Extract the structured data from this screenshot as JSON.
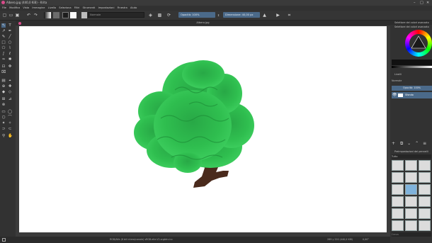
{
  "window": {
    "title": "Albero.jpg (440,0 KiB) - Krita",
    "minimize": "–",
    "maximize": "□",
    "close": "✕"
  },
  "menu": [
    "File",
    "Modifica",
    "Vista",
    "Immagine",
    "Livello",
    "Seleziona",
    "Filtri",
    "Strumenti",
    "Impostazioni",
    "Finestra",
    "Aiuto"
  ],
  "toolbar": {
    "brush_preset_placeholder": "Normale",
    "opacity_label": "Opacità: 100%",
    "size_label": "Dimensione: 40,00 px"
  },
  "document": {
    "tab_title": "Albero.jpg"
  },
  "status": {
    "color_info": "RGB/Alfa (8 bit intero/canale)  sRGB-elle-V2-srgbtrc.icc",
    "dimensions": "289 y 220 (440,0 KiB)",
    "rotation": "0,00°",
    "zoom": "166,6%"
  },
  "docker": {
    "color_selector_title": "Selettore dei colori avanzato",
    "color_selector_tab": "Selettore dei colori avanzato",
    "layers_title": "Livelli",
    "blend_mode": "Normale",
    "layer_opacity": "Opacità: 100%",
    "layer_name": "Sfondo",
    "brush_presets_title": "Preimpostazioni dei pennelli",
    "brush_tag": "Tutto",
    "brush_search_placeholder": "Cerca"
  },
  "colors": {
    "accent": "#4b6a8a",
    "canvas_bg": "#ffffff",
    "tree_foliage": "#2db64a",
    "tree_trunk": "#4a2a1c"
  }
}
